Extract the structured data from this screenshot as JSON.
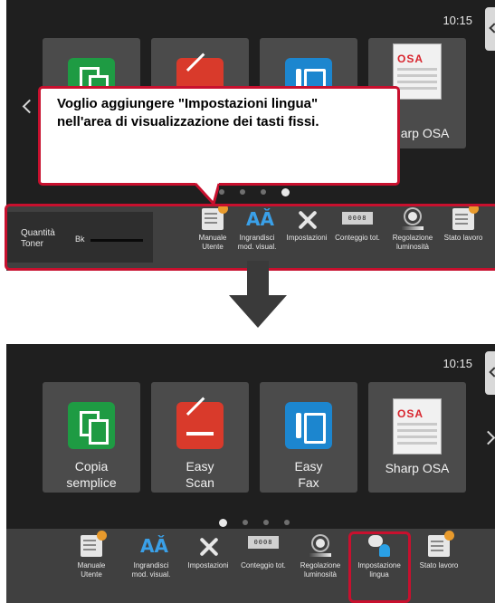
{
  "screen_before": {
    "clock": "10:15",
    "tiles": [
      {
        "label": ""
      },
      {
        "label": ""
      },
      {
        "label": ""
      },
      {
        "label": "Sharp OSA"
      }
    ],
    "pager": {
      "count": 4,
      "active": 3
    },
    "toner": {
      "label": "Quantità\nToner",
      "color": "Bk"
    },
    "keys": [
      {
        "label": "Manuale\nUtente",
        "icon": "manual-icon"
      },
      {
        "label": "Ingrandisci\nmod. visual.",
        "icon": "zoom-icon"
      },
      {
        "label": "Impostazioni",
        "icon": "settings-icon"
      },
      {
        "label": "Conteggio tot.",
        "icon": "counter-icon"
      },
      {
        "label": "Regolazione\nluminosità",
        "icon": "brightness-icon"
      },
      {
        "label": "Stato lavoro",
        "icon": "job-status-icon"
      }
    ]
  },
  "callout": {
    "text": "Voglio aggiungere \"Impostazioni lingua\"\nnell'area di visualizzazione dei tasti fissi."
  },
  "screen_after": {
    "clock": "10:15",
    "tiles": [
      {
        "label": "Copia\nsemplice"
      },
      {
        "label": "Easy\nScan"
      },
      {
        "label": "Easy\nFax"
      },
      {
        "label": "Sharp OSA"
      }
    ],
    "osa_logo": "OSA",
    "counter_display": "0008",
    "pager": {
      "count": 4,
      "active": 0
    },
    "keys": [
      {
        "label": "Manuale\nUtente",
        "icon": "manual-icon"
      },
      {
        "label": "Ingrandisci\nmod. visual.",
        "icon": "zoom-icon"
      },
      {
        "label": "Impostazioni",
        "icon": "settings-icon"
      },
      {
        "label": "Conteggio tot.",
        "icon": "counter-icon"
      },
      {
        "label": "Regolazione\nluminosità",
        "icon": "brightness-icon"
      },
      {
        "label": "Impostazione\nlingua",
        "icon": "language-icon"
      },
      {
        "label": "Stato lavoro",
        "icon": "job-status-icon"
      }
    ]
  },
  "colors": {
    "highlight": "#c8102e",
    "screen": "#1f1f1f",
    "taskbar": "#404040",
    "tile": "#4b4b4b"
  }
}
